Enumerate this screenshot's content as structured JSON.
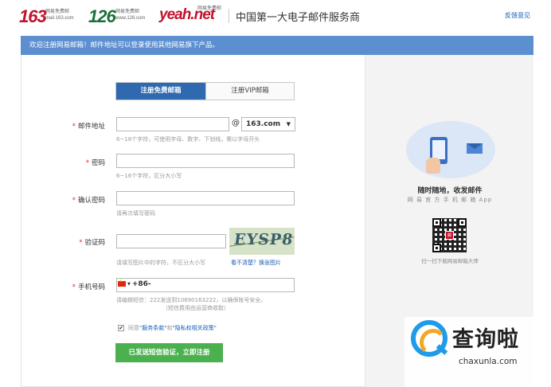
{
  "header": {
    "logos": [
      {
        "num": "163",
        "sub1": "网易免费邮",
        "sub2": "mail.163.com"
      },
      {
        "num": "126",
        "sub1": "网易免费邮",
        "sub2": "www.126.com"
      },
      {
        "num": "yeah.net",
        "sub1": "网易免费邮",
        "sub2": ""
      }
    ],
    "slogan": "中国第一大电子邮件服务商",
    "feedback": "反馈意见"
  },
  "banner": "欢迎注册网易邮箱！邮件地址可以登录使用其他网易旗下产品。",
  "tabs": {
    "free": "注册免费邮箱",
    "vip": "注册VIP邮箱"
  },
  "form": {
    "required_mark": "*",
    "email": {
      "label": "邮件地址",
      "value": "",
      "at": "@",
      "domain": "163.com",
      "hint": "6~18个字符，可使用字母、数字、下划线，需以字母开头"
    },
    "password": {
      "label": "密码",
      "value": "",
      "hint": "6~16个字符，区分大小写"
    },
    "confirm_password": {
      "label": "确认密码",
      "value": "",
      "hint": "请再次填写密码"
    },
    "captcha": {
      "label": "验证码",
      "value": "",
      "image_text": "EYSP8",
      "hint": "请填写图片中的字符，不区分大小写",
      "refresh": "看不清楚？换张图片"
    },
    "phone": {
      "label": "手机号码",
      "prefix": "+86-",
      "value": "",
      "hint1": "请编辑短信：222发送到10690163222，以确保账号安全。",
      "hint2": "（短信费用由运营商收取）"
    },
    "agreement": {
      "checked": "✔",
      "text_pre": "同意",
      "terms": "\"服务条款\"",
      "and": "和",
      "privacy": "\"隐私权相关政策\""
    },
    "submit": "已发送短信验证，立即注册"
  },
  "sidebar": {
    "title": "随时随地，收发邮件",
    "subtitle": "网 易 官 方 手 机 邮 箱 App",
    "qr_logo": "邮",
    "qr_caption": "扫一扫下载网易邮箱大师"
  },
  "watermark": {
    "text": "查询啦",
    "url": "chaxunla.com"
  },
  "colors": {
    "banner": "#5c8fd0",
    "tab_active": "#2f6ab0",
    "submit": "#4bb04e",
    "required": "#e02b2b",
    "link": "#1a5fb4"
  }
}
